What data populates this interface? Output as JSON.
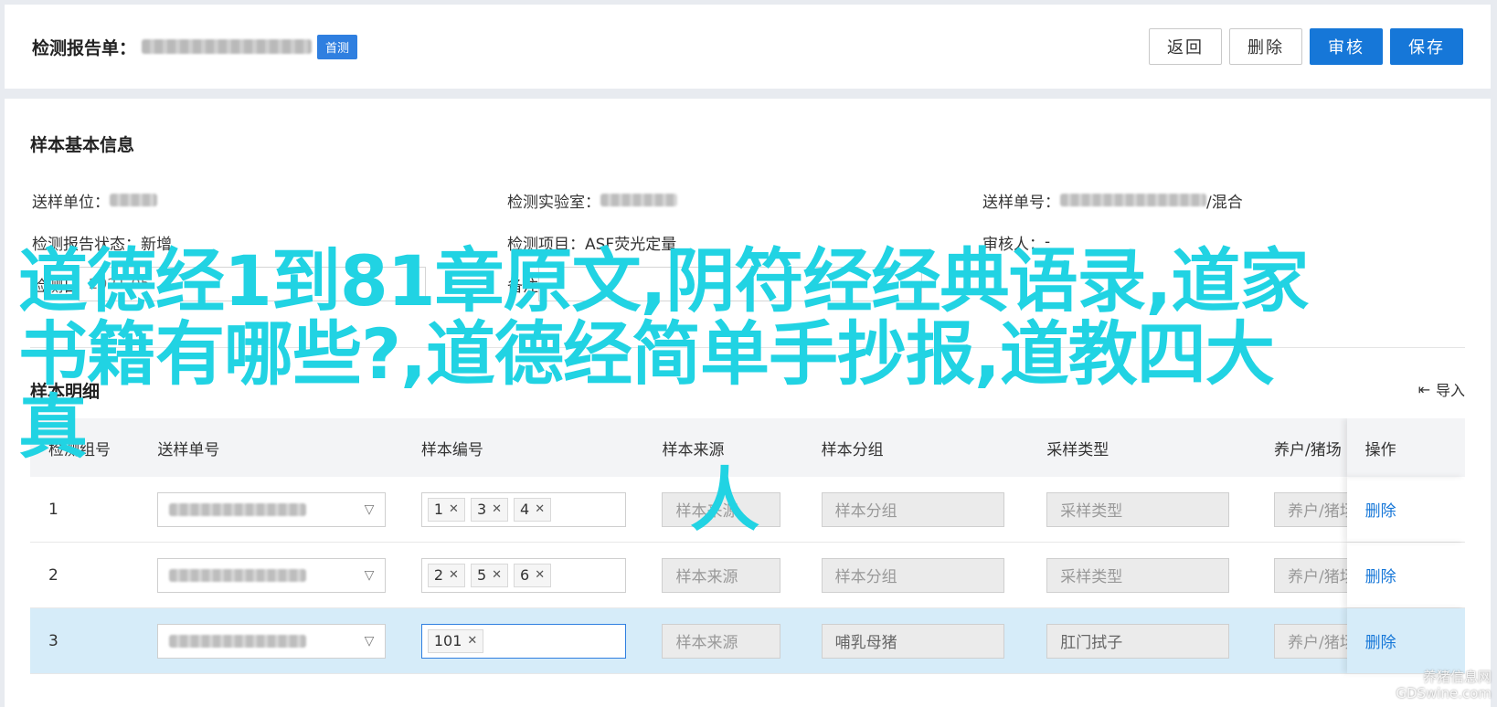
{
  "header": {
    "title": "检测报告单：",
    "badge": "首测",
    "actions": {
      "back": "返回",
      "delete": "删除",
      "review": "审核",
      "save": "保存"
    }
  },
  "basic_info": {
    "title": "样本基本信息",
    "fields": {
      "send_unit_label": "送样单位：",
      "lab_label": "检测实验室：",
      "send_no_label": "送样单号：",
      "send_no_suffix": "/混合",
      "status_label": "检测报告状态：",
      "status_value": "新增",
      "item_label": "检测项目：",
      "item_value": "ASF荧光定量",
      "reviewer_label": "审核人：",
      "reviewer_value": "-",
      "time_label": "检测日",
      "time_value": "2021-05",
      "remark_label": "备注"
    }
  },
  "detail": {
    "title": "样本明细",
    "import_label": "导入",
    "columns": [
      "检测组号",
      "送样单号",
      "样本编号",
      "样本来源",
      "样本分组",
      "采样类型",
      "养户/猪场",
      "操作"
    ],
    "placeholders": {
      "source": "样本来源",
      "group": "样本分组",
      "type": "采样类型",
      "farm": "养户/猪场"
    },
    "rows": [
      {
        "group_no": "1",
        "tags": [
          "1",
          "3",
          "4"
        ],
        "source": "样本来源",
        "group": "样本分组",
        "type": "采样类型",
        "farm": "养户/猪场",
        "action": "删除"
      },
      {
        "group_no": "2",
        "tags": [
          "2",
          "5",
          "6"
        ],
        "source": "样本来源",
        "group": "样本分组",
        "type": "采样类型",
        "farm": "养户/猪场",
        "action": "删除"
      },
      {
        "group_no": "3",
        "tags": [
          "101"
        ],
        "source": "样本来源",
        "group": "哺乳母猪",
        "type": "肛门拭子",
        "farm": "养户/猪场",
        "action": "删除"
      }
    ]
  },
  "overlay": {
    "line1": "道德经1到81章原文,阴符经经典语录,道家",
    "line2": "书籍有哪些?,道德经简单手抄报,道教四大真",
    "line3": "人",
    "site_line1": "养猪信息网",
    "site_line2": "GDSwine.com"
  },
  "colors": {
    "primary": "#1677d8",
    "overlay": "#21d3e3",
    "selected_row": "#d6ecf9"
  }
}
